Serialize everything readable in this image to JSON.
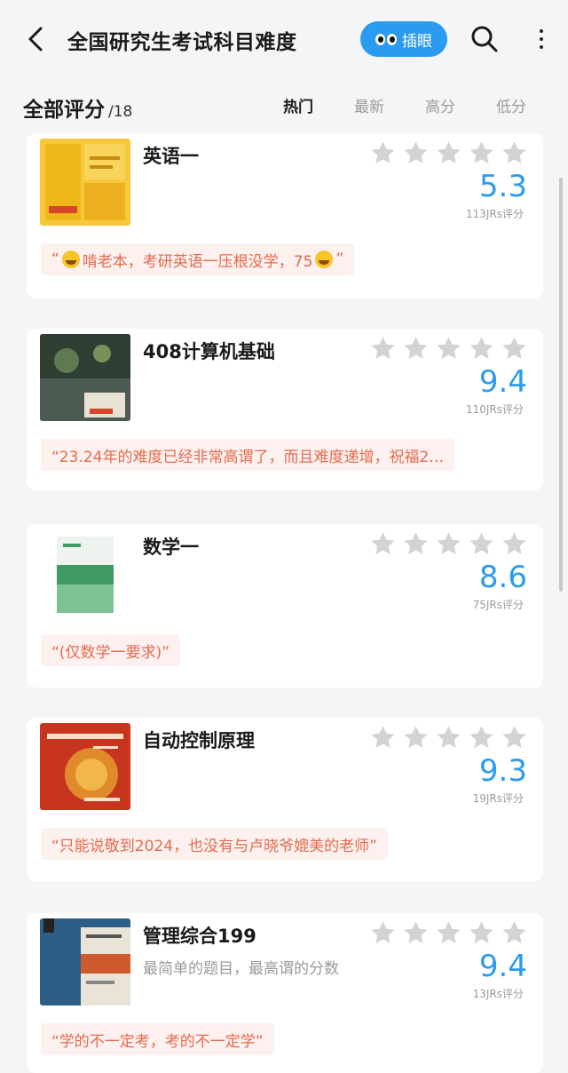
{
  "header": {
    "title": "全国研究生考试科目难度",
    "cha_label": "插眼"
  },
  "filter": {
    "section_title": "全部评分",
    "section_count": "/18",
    "tabs": [
      "热门",
      "最新",
      "高分",
      "低分"
    ]
  },
  "colors": {
    "accent": "#2a9bf0",
    "quote_text": "#e46a4e",
    "star_empty": "#d3d3d3"
  },
  "items": [
    {
      "name": "英语一",
      "subtitle": "",
      "score": "5.3",
      "count": "113JRs评分",
      "quote_before": "“",
      "quote_mid": "啃老本，考研英语一压根没学，75",
      "quote_after": "”"
    },
    {
      "name": "408计算机基础",
      "subtitle": "",
      "score": "9.4",
      "count": "110JRs评分",
      "quote": "“23.24年的难度已经非常高谓了，而且难度递增，祝福2…"
    },
    {
      "name": "数学一",
      "subtitle": "",
      "score": "8.6",
      "count": "75JRs评分",
      "quote": "“(仅数学一要求)”"
    },
    {
      "name": "自动控制原理",
      "subtitle": "",
      "score": "9.3",
      "count": "19JRs评分",
      "quote": "“只能说敬到2024，也没有与卢晓爷媲美的老师”"
    },
    {
      "name": "管理综合199",
      "subtitle": "最简单的题目，最高谓的分数",
      "score": "9.4",
      "count": "13JRs评分",
      "quote": "“学的不一定考，考的不一定学”"
    }
  ]
}
